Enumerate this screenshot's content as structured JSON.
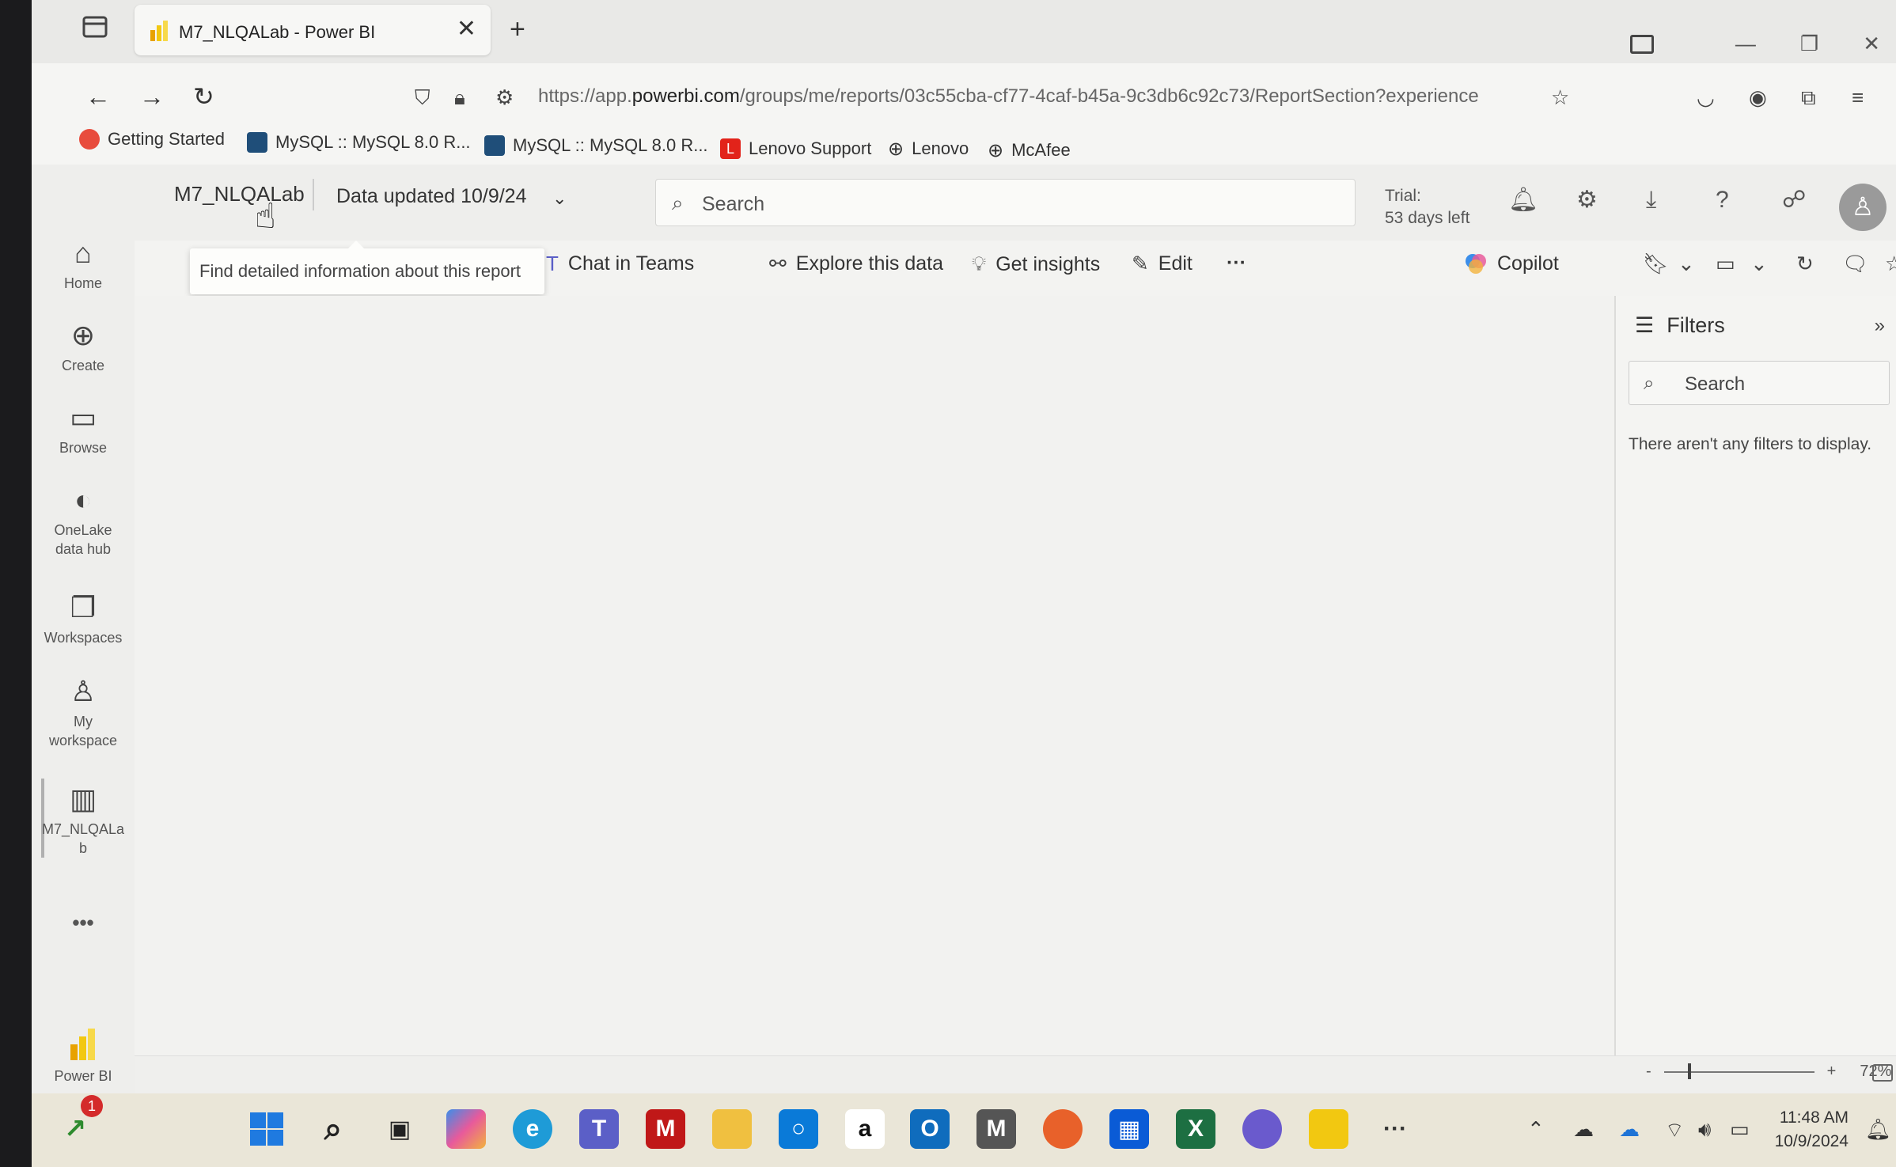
{
  "browser": {
    "tab_title": "M7_NLQALab - Power BI",
    "tab_close": "✕",
    "new_tab": "+",
    "url_prefix": "https://app.",
    "url_domain": "powerbi.com",
    "url_rest": "/groups/me/reports/03c55cba-cf77-4caf-b45a-9c3db6c92c73/ReportSection?experience"
  },
  "bookmarks": [
    {
      "label": "Getting Started",
      "color": "#e84c3d"
    },
    {
      "label": "MySQL :: MySQL 8.0 R...",
      "color": "#1f4e79"
    },
    {
      "label": "MySQL :: MySQL 8.0 R...",
      "color": "#1f4e79"
    },
    {
      "label": "Lenovo Support",
      "color": "#e2231a"
    },
    {
      "label": "Lenovo",
      "color": "#444444"
    },
    {
      "label": "McAfee",
      "color": "#444444"
    }
  ],
  "header": {
    "report_name": "M7_NLQALab",
    "data_updated": "Data updated 10/9/24",
    "search_placeholder": "Search",
    "trial_label": "Trial:",
    "trial_days": "53 days left"
  },
  "leftnav": {
    "home": "Home",
    "create": "Create",
    "browse": "Browse",
    "onelake_1": "OneLake",
    "onelake_2": "data hub",
    "workspaces": "Workspaces",
    "my_workspace_1": "My",
    "my_workspace_2": "workspace",
    "report_1": "M7_NLQALa",
    "report_2": "b",
    "more": "•••",
    "powerbi": "Power BI"
  },
  "actionbar": {
    "tooltip": "Find detailed information about this report",
    "chat_in_teams": "Chat in Teams",
    "explore": "Explore this data",
    "get_insights": "Get insights",
    "edit": "Edit",
    "more": "···",
    "copilot": "Copilot"
  },
  "filters": {
    "title": "Filters",
    "search_placeholder": "Search",
    "empty_text": "There aren't any filters to display."
  },
  "statusbar": {
    "zoom_minus": "-",
    "zoom_plus": "+",
    "zoom_level": "72%",
    "zoom_value": 72
  },
  "taskbar": {
    "notification_count": "1",
    "time": "11:48 AM",
    "date": "10/9/2024",
    "more": "···"
  },
  "colors": {
    "powerbi_yellow": "#f2c811",
    "excel_green": "#1d6f42",
    "outlook_blue": "#0f6cbd",
    "teams_purple": "#5b5fc7"
  }
}
